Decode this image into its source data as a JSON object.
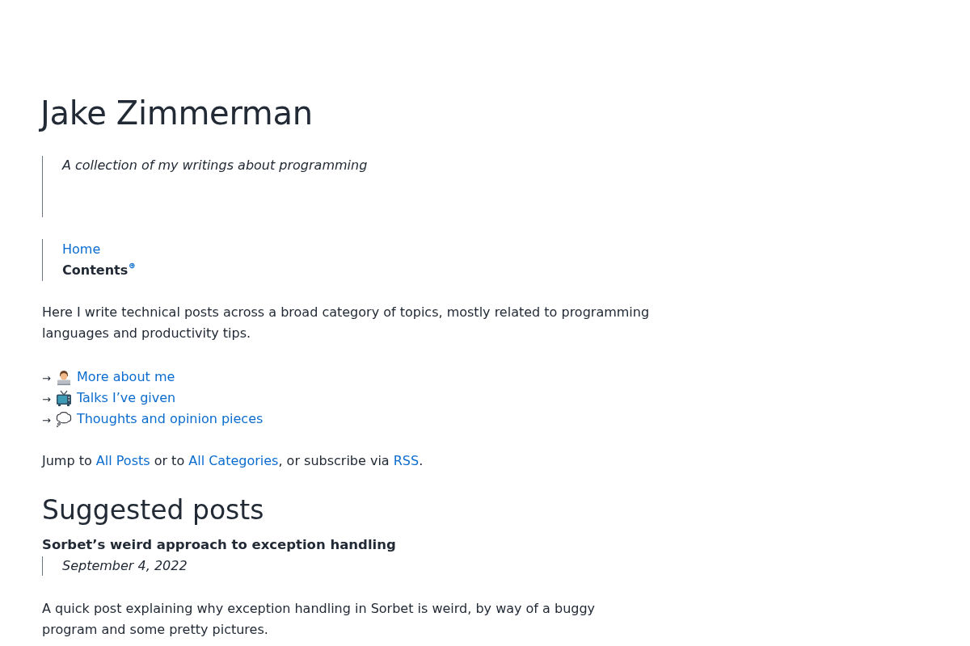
{
  "site": {
    "title": "Jake Zimmerman",
    "tagline": "A collection of my writings about programming"
  },
  "nav": [
    {
      "label": "Home",
      "selected": false
    },
    {
      "label": "Contents",
      "selected": true,
      "toggle": "⊕"
    }
  ],
  "intro": "Here I write technical posts across a broad category of topics, mostly related to programming languages and productivity tips.",
  "links": [
    {
      "arrow": "→",
      "kind": "technologist",
      "label": "More about me"
    },
    {
      "arrow": "→",
      "kind": "television",
      "label": "Talks I’ve given"
    },
    {
      "arrow": "→",
      "kind": "thought",
      "label": "Thoughts and opinion pieces"
    }
  ],
  "jump": [
    {
      "kind": "text",
      "text": "Jump to "
    },
    {
      "kind": "link",
      "text": "All Posts"
    },
    {
      "kind": "text",
      "text": " or to "
    },
    {
      "kind": "link",
      "text": "All Categories"
    },
    {
      "kind": "text",
      "text": ", or subscribe via "
    },
    {
      "kind": "link",
      "text": "RSS"
    },
    {
      "kind": "text",
      "text": "."
    }
  ],
  "suggested": {
    "heading": "Suggested posts",
    "posts": [
      {
        "title": "Sorbet’s weird approach to exception handling",
        "date": "September 4, 2022",
        "summary": "A quick post explaining why exception handling in Sorbet is weird, by way of a buggy program and some pretty pictures."
      }
    ]
  }
}
